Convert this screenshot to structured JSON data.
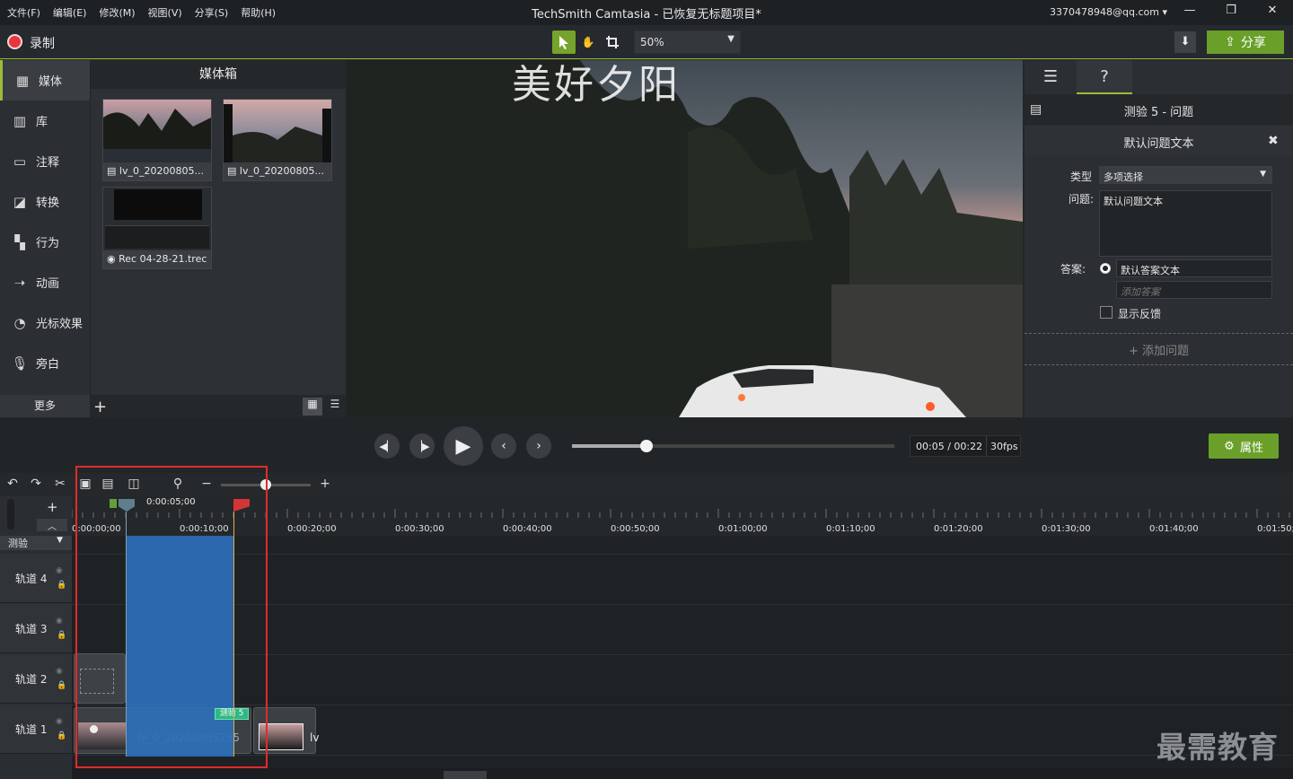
{
  "menu": [
    "文件(F)",
    "编辑(E)",
    "修改(M)",
    "视图(V)",
    "分享(S)",
    "帮助(H)"
  ],
  "window_title": "TechSmith Camtasia - 已恢复无标题项目*",
  "account": "3370478948@qq.com",
  "record_label": "录制",
  "zoom": "50%",
  "share_label": "分享",
  "sidebar": {
    "items": [
      {
        "icon": "media-icon",
        "label": "媒体"
      },
      {
        "icon": "library-icon",
        "label": "库"
      },
      {
        "icon": "annotation-icon",
        "label": "注释"
      },
      {
        "icon": "transition-icon",
        "label": "转换"
      },
      {
        "icon": "behavior-icon",
        "label": "行为"
      },
      {
        "icon": "animation-icon",
        "label": "动画"
      },
      {
        "icon": "cursor-effect-icon",
        "label": "光标效果"
      },
      {
        "icon": "voice-icon",
        "label": "旁白"
      }
    ],
    "more": "更多"
  },
  "bin": {
    "title": "媒体箱",
    "items": [
      {
        "name": "lv_0_20200805..."
      },
      {
        "name": "lv_0_20200805..."
      },
      {
        "name": "Rec 04-28-21.trec"
      }
    ]
  },
  "preview": {
    "title_text": "美好夕阳"
  },
  "quiz": {
    "header": "测验 5 - 问题",
    "question_title": "默认问题文本",
    "type_label": "类型",
    "type_value": "多项选择",
    "question_label": "问题:",
    "question_value": "默认问题文本",
    "answer_label": "答案:",
    "answer_value": "默认答案文本",
    "answer_placeholder": "添加答案",
    "feedback_label": "显示反馈",
    "add_question": "+ 添加问题"
  },
  "playback": {
    "time": "00:05 / 00:22",
    "fps": "30fps",
    "properties_label": "属性",
    "progress": 0.23
  },
  "timeline": {
    "playhead": "0:00:05;00",
    "quiz_marker": "测验",
    "ticks": [
      "0:00:00;00",
      "0:00:10;00",
      "0:00:20;00",
      "0:00:30;00",
      "0:00:40;00",
      "0:00:50;00",
      "0:01:00;00",
      "0:01:10;00",
      "0:01:20;00",
      "0:01:30;00",
      "0:01:40;00",
      "0:01:50;"
    ],
    "tracks": [
      "轨道 4",
      "轨道 3",
      "轨道 2",
      "轨道 1"
    ],
    "clip_label": "lv_0_20200805235",
    "quiz_badge": "测验 5",
    "clip2_label": "lv"
  },
  "watermark": "最需教育"
}
